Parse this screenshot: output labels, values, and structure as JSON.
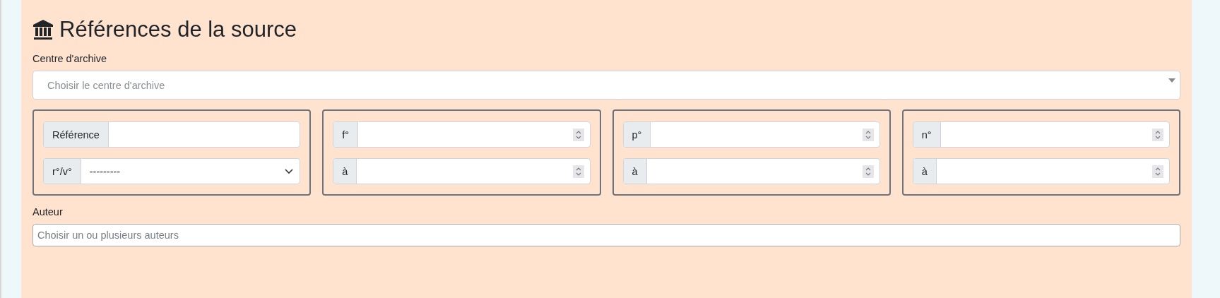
{
  "heading": "Références de la source",
  "archive": {
    "label": "Centre d'archive",
    "placeholder": "Choisir le centre d'archive"
  },
  "groups": [
    {
      "rows": [
        {
          "kind": "text",
          "addon": "Référence"
        },
        {
          "kind": "select",
          "addon": "r°/v°",
          "value": "---------"
        }
      ]
    },
    {
      "rows": [
        {
          "kind": "number",
          "addon": "f°"
        },
        {
          "kind": "number",
          "addon": "à"
        }
      ]
    },
    {
      "rows": [
        {
          "kind": "number",
          "addon": "p°"
        },
        {
          "kind": "number",
          "addon": "à"
        }
      ]
    },
    {
      "rows": [
        {
          "kind": "number",
          "addon": "n°"
        },
        {
          "kind": "number",
          "addon": "à"
        }
      ]
    }
  ],
  "author": {
    "label": "Auteur",
    "placeholder": "Choisir un ou plusieurs auteurs"
  }
}
